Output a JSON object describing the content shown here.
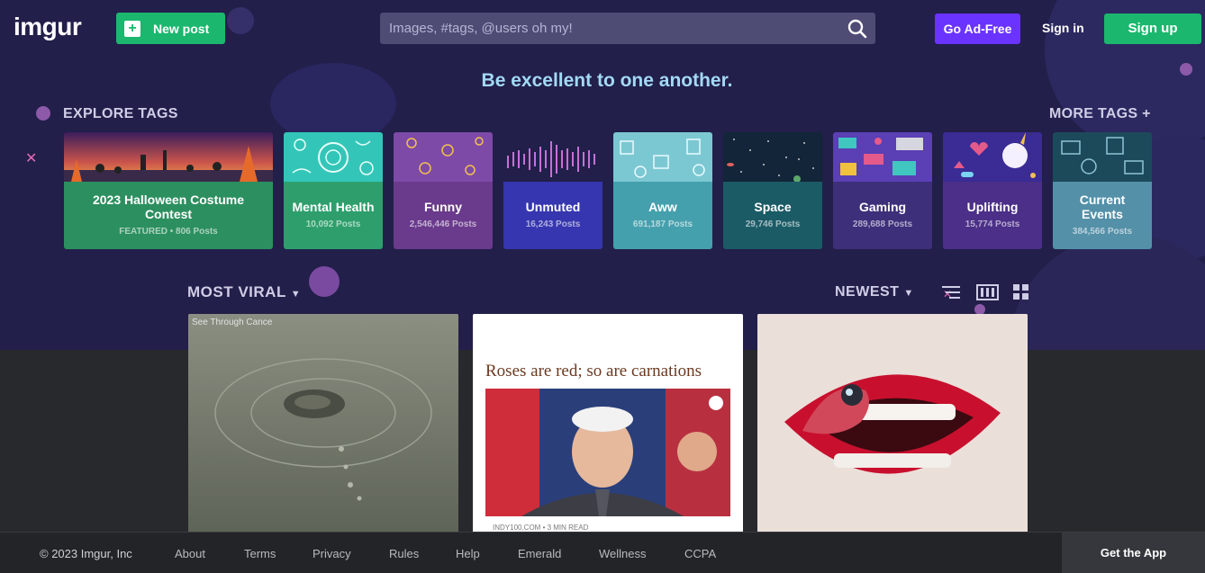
{
  "header": {
    "logo": "imgur",
    "new_post_label": "New post",
    "search_placeholder": "Images, #tags, @users oh my!",
    "go_adfree_label": "Go Ad-Free",
    "signin_label": "Sign in",
    "signup_label": "Sign up"
  },
  "tagline": "Be excellent to one another.",
  "explore": {
    "title": "EXPLORE TAGS",
    "more_label": "MORE TAGS +",
    "tags": [
      {
        "name": "2023 Halloween Costume Contest",
        "posts": "FEATURED • 806 Posts",
        "color": "#2c8f5f"
      },
      {
        "name": "Mental Health",
        "posts": "10,092 Posts",
        "color": "#2e9f6c"
      },
      {
        "name": "Funny",
        "posts": "2,546,446 Posts",
        "color": "#6a3a8c"
      },
      {
        "name": "Unmuted",
        "posts": "16,243 Posts",
        "color": "#3636b0"
      },
      {
        "name": "Aww",
        "posts": "691,187 Posts",
        "color": "#45a0ad"
      },
      {
        "name": "Space",
        "posts": "29,746 Posts",
        "color": "#1b5b66"
      },
      {
        "name": "Gaming",
        "posts": "289,688 Posts",
        "color": "#3d2f7a"
      },
      {
        "name": "Uplifting",
        "posts": "15,774 Posts",
        "color": "#4b2f88"
      },
      {
        "name": "Current Events",
        "posts": "384,566 Posts",
        "color": "#5490a8"
      }
    ]
  },
  "feed": {
    "sort_label": "MOST VIRAL",
    "order_label": "NEWEST",
    "posts": [
      {
        "watermark": "See Through Cance"
      },
      {
        "title": "Roses are red; so are carnations",
        "source": "INDY100.COM • 3 MIN READ"
      },
      {}
    ]
  },
  "footer": {
    "copyright": "© 2023 Imgur, Inc",
    "links": [
      "About",
      "Terms",
      "Privacy",
      "Rules",
      "Help",
      "Emerald",
      "Wellness",
      "CCPA"
    ],
    "get_app": "Get the App"
  }
}
